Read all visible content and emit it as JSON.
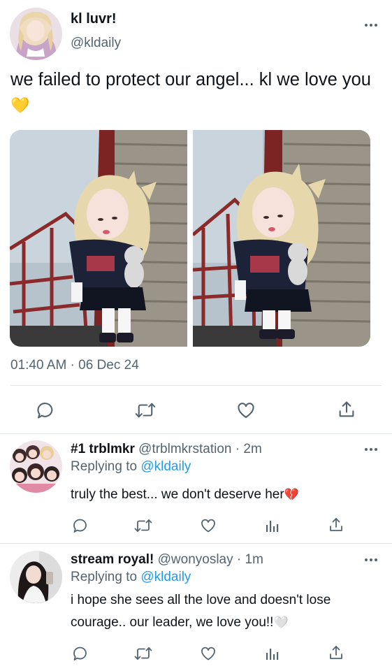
{
  "main_tweet": {
    "display_name": "kl luvr!",
    "handle": "@kldaily",
    "text": "we failed to protect our angel... kl we love you",
    "text_emoji": "💛",
    "timestamp": "01:40 AM · 06 Dec 24"
  },
  "replies": [
    {
      "display_name": "#1 trblmkr",
      "handle": "@trblmkrstation",
      "time": "· 2m",
      "replying_prefix": "Replying to",
      "replying_to": "@kldaily",
      "text": "truly the best... we don't deserve her",
      "text_emoji": "💔"
    },
    {
      "display_name": "stream royal!",
      "handle": "@wonyoslay",
      "time": "· 1m",
      "replying_prefix": "Replying to",
      "replying_to": "@kldaily",
      "text": "i hope she sees all the love and doesn't lose courage.. our leader, we love you!!",
      "text_emoji": "🤍"
    }
  ],
  "icons": {
    "main_actions": [
      "reply-icon",
      "retweet-icon",
      "like-icon",
      "share-icon"
    ],
    "reply_actions": [
      "reply-icon",
      "retweet-icon",
      "like-icon",
      "analytics-icon",
      "share-icon"
    ],
    "more": "more-options-icon"
  },
  "colors": {
    "text": "#0f1419",
    "secondary": "#536471",
    "link": "#1d9bf0",
    "divider": "#e1e6ea",
    "heart_yellow": "#f5c23a",
    "heart_red": "#e0243e"
  }
}
